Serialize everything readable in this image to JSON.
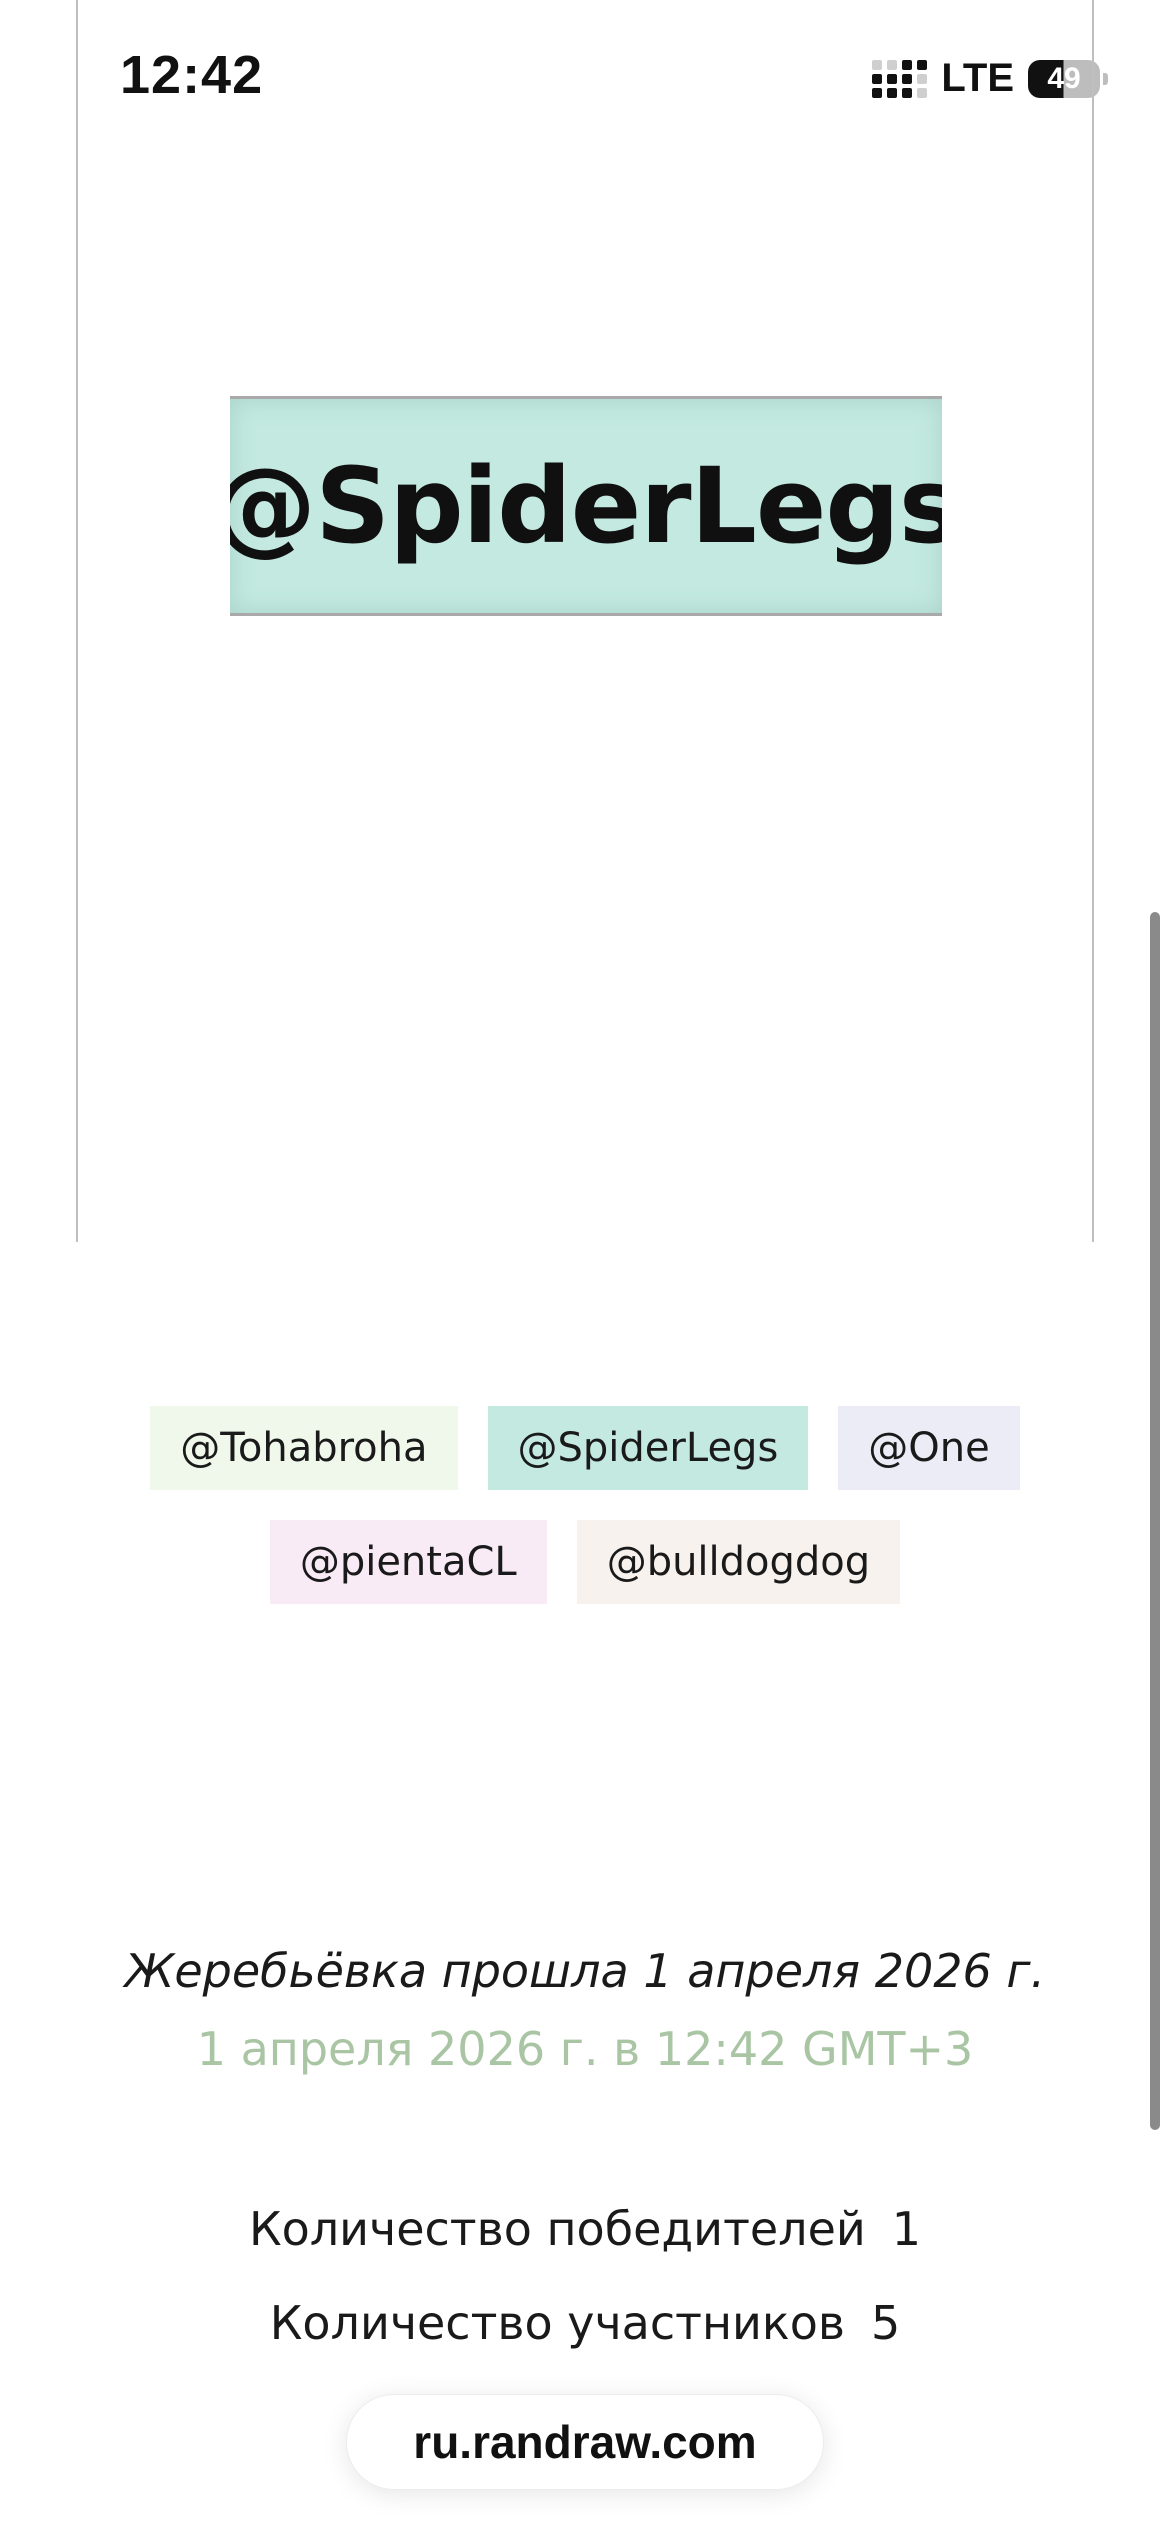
{
  "status_bar": {
    "time": "12:42",
    "network": "LTE",
    "battery": "49"
  },
  "winner": {
    "name": "@SpiderLegs",
    "color": "#c3e9e0"
  },
  "participants": [
    {
      "name": "@Tohabroha",
      "color": "#f0f8ec"
    },
    {
      "name": "@SpiderLegs",
      "color": "#c3e9e0"
    },
    {
      "name": "@One",
      "color": "#ececf7"
    },
    {
      "name": "@pientaCL",
      "color": "#f8ebf5"
    },
    {
      "name": "@bulldogdog",
      "color": "#f8f2ee"
    }
  ],
  "draw_info": {
    "date_text": "Жеребьёвка прошла 1 апреля 2026 г.",
    "time_text": "1 апреля 2026 г. в 12:42 GMT+3"
  },
  "stats": {
    "winners_label": "Количество победителей",
    "winners_count": "1",
    "participants_label": "Количество участников",
    "participants_count": "5"
  },
  "browser": {
    "url": "ru.randraw.com"
  }
}
